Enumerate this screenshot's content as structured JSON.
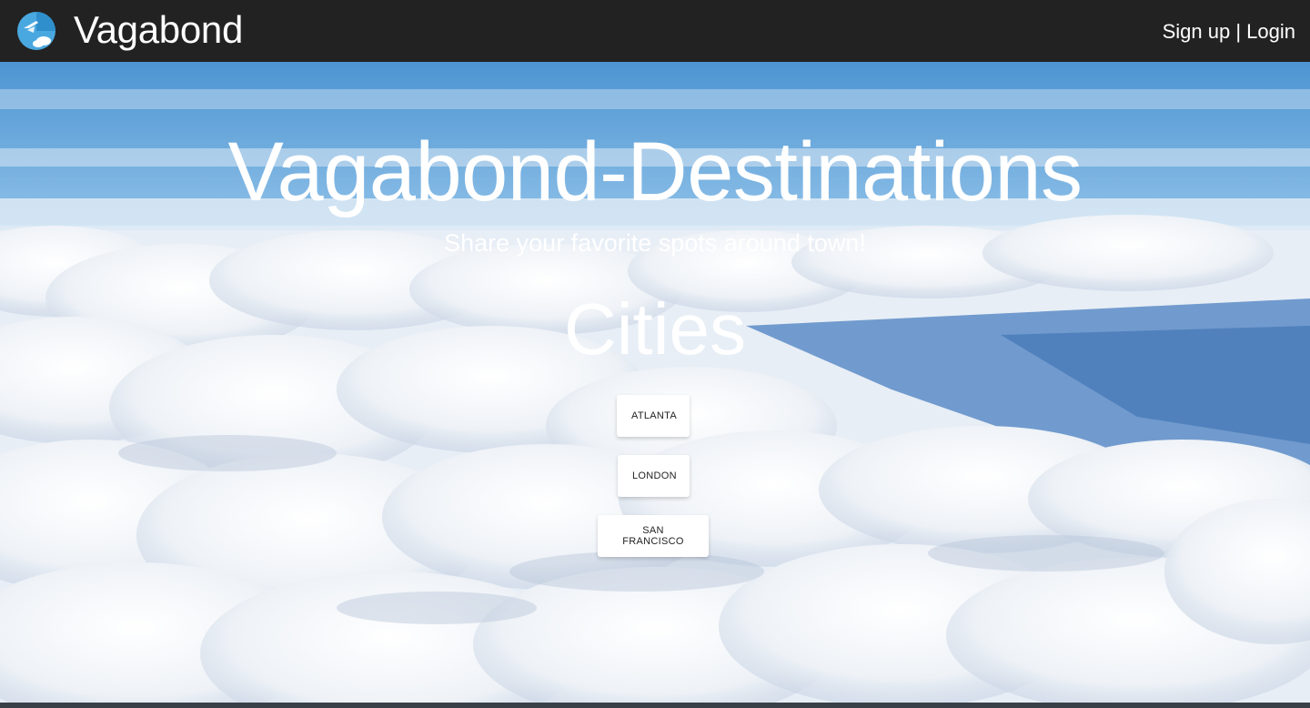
{
  "app": {
    "brand": "Vagabond",
    "logo_icon": "plane-globe-icon"
  },
  "nav": {
    "signup_label": "Sign up",
    "separator": " | ",
    "login_label": "Login"
  },
  "hero": {
    "headline": "Vagabond-Destinations",
    "tagline": "Share your favorite spots around town!",
    "cities_title": "Cities",
    "background": "sky-above-clouds"
  },
  "cities": [
    {
      "label": "ATLANTA"
    },
    {
      "label": "LONDON"
    },
    {
      "label": "SAN FRANCISCO"
    }
  ],
  "colors": {
    "navbar": "#222222",
    "sky": "#5b9fd6",
    "text": "#ffffff",
    "button_bg": "#ffffff"
  }
}
